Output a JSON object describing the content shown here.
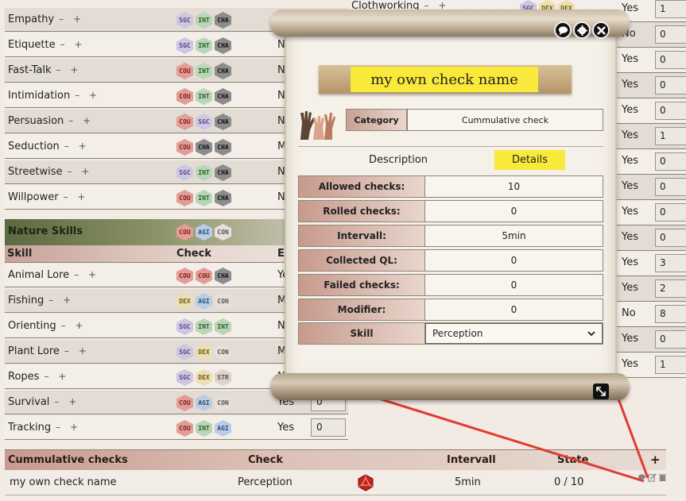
{
  "left_skills_top": [
    {
      "name": "Empathy",
      "attrs": [
        "SGC",
        "INT",
        "CHA"
      ],
      "eff": "",
      "fp": ""
    },
    {
      "name": "Etiquette",
      "attrs": [
        "SGC",
        "INT",
        "CHA"
      ],
      "eff": "N",
      "fp": ""
    },
    {
      "name": "Fast-Talk",
      "attrs": [
        "COU",
        "INT",
        "CHA"
      ],
      "eff": "N",
      "fp": ""
    },
    {
      "name": "Intimidation",
      "attrs": [
        "COU",
        "INT",
        "CHA"
      ],
      "eff": "N",
      "fp": ""
    },
    {
      "name": "Persuasion",
      "attrs": [
        "COU",
        "SGC",
        "CHA"
      ],
      "eff": "N",
      "fp": ""
    },
    {
      "name": "Seduction",
      "attrs": [
        "COU",
        "CHA",
        "CHA"
      ],
      "eff": "M",
      "fp": ""
    },
    {
      "name": "Streetwise",
      "attrs": [
        "SGC",
        "INT",
        "CHA"
      ],
      "eff": "N",
      "fp": ""
    },
    {
      "name": "Willpower",
      "attrs": [
        "COU",
        "INT",
        "CHA"
      ],
      "eff": "N",
      "fp": ""
    }
  ],
  "nature_group": {
    "title": "Nature Skills",
    "attrs": [
      "COU",
      "AGI",
      "CON"
    ],
    "col_skill": "Skill",
    "col_check": "Check",
    "col_e": "E"
  },
  "nature_skills": [
    {
      "name": "Animal Lore",
      "attrs": [
        "COU",
        "COU",
        "CHA"
      ],
      "eff": "Ye",
      "fp": ""
    },
    {
      "name": "Fishing",
      "attrs": [
        "DEX",
        "AGI",
        "CON"
      ],
      "eff": "M",
      "fp": ""
    },
    {
      "name": "Orienting",
      "attrs": [
        "SGC",
        "INT",
        "INT"
      ],
      "eff": "N",
      "fp": ""
    },
    {
      "name": "Plant Lore",
      "attrs": [
        "SGC",
        "DEX",
        "CON"
      ],
      "eff": "M",
      "fp": ""
    },
    {
      "name": "Ropes",
      "attrs": [
        "SGC",
        "DEX",
        "STR"
      ],
      "eff": "N",
      "fp": ""
    },
    {
      "name": "Survival",
      "attrs": [
        "COU",
        "AGI",
        "CON"
      ],
      "eff": "Yes",
      "fp": "0"
    },
    {
      "name": "Tracking",
      "attrs": [
        "COU",
        "INT",
        "AGI"
      ],
      "eff": "Yes",
      "fp": "0"
    }
  ],
  "right_rows": [
    {
      "name": "Clothworking",
      "attrs": [
        "SGC",
        "DEX",
        "DEX"
      ],
      "eff": "Yes",
      "val": "1"
    },
    {
      "name": "",
      "attrs": [],
      "eff": "No",
      "val": "0"
    },
    {
      "name": "",
      "attrs": [],
      "eff": "Yes",
      "val": "0"
    },
    {
      "name": "",
      "attrs": [],
      "eff": "Yes",
      "val": "0"
    },
    {
      "name": "",
      "attrs": [],
      "eff": "Yes",
      "val": "0"
    },
    {
      "name": "",
      "attrs": [],
      "eff": "Yes",
      "val": "1"
    },
    {
      "name": "",
      "attrs": [],
      "eff": "Yes",
      "val": "0"
    },
    {
      "name": "",
      "attrs": [],
      "eff": "Yes",
      "val": "0"
    },
    {
      "name": "",
      "attrs": [],
      "eff": "Yes",
      "val": "0"
    },
    {
      "name": "",
      "attrs": [],
      "eff": "Yes",
      "val": "0"
    },
    {
      "name": "",
      "attrs": [],
      "eff": "Yes",
      "val": "3"
    },
    {
      "name": "",
      "attrs": [],
      "eff": "Yes",
      "val": "2"
    },
    {
      "name": "",
      "attrs": [],
      "eff": "No",
      "val": "8"
    },
    {
      "name": "",
      "attrs": [],
      "eff": "Yes",
      "val": "0"
    },
    {
      "name": "",
      "attrs": [],
      "eff": "Yes",
      "val": "1"
    }
  ],
  "plus_minus": "– +",
  "dialog": {
    "title": "my own check name",
    "category_label": "Category",
    "category_value": "Cummulative check",
    "tab_description": "Description",
    "tab_details": "Details",
    "fields": [
      {
        "label": "Allowed checks:",
        "value": "10"
      },
      {
        "label": "Rolled checks:",
        "value": "0"
      },
      {
        "label": "Intervall:",
        "value": "5min"
      },
      {
        "label": "Collected QL:",
        "value": "0"
      },
      {
        "label": "Failed checks:",
        "value": "0"
      },
      {
        "label": "Modifier:",
        "value": "0"
      }
    ],
    "skill_label": "Skill",
    "skill_value": "Perception"
  },
  "cumulative": {
    "header": {
      "title": "Cummulative checks",
      "check": "Check",
      "interval": "Intervall",
      "state": "State",
      "add": "+"
    },
    "rows": [
      {
        "name": "my own check name",
        "check": "Perception",
        "interval": "5min",
        "state": "0 / 10"
      }
    ]
  },
  "colors": {
    "highlight": "#f8e93a",
    "annotation_line": "#e03c31",
    "group_header": "#5c6940"
  }
}
